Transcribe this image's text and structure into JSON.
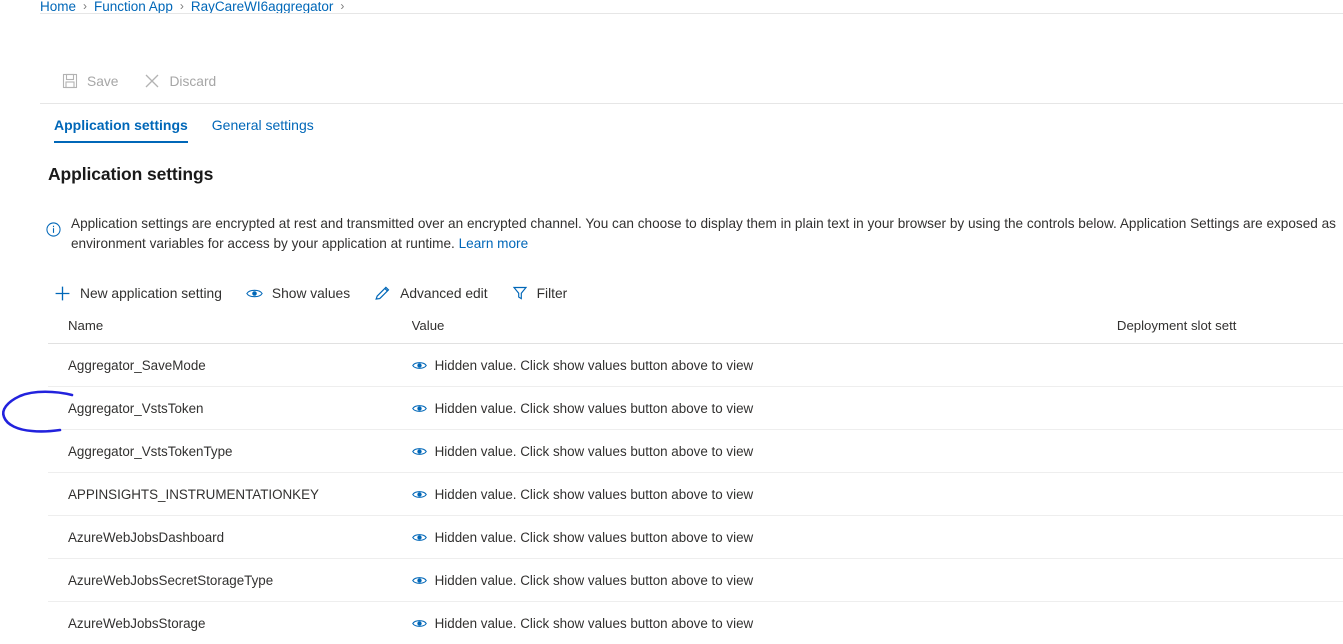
{
  "breadcrumb": {
    "items": [
      "Home",
      "Function App",
      "RayCareWI6aggregator"
    ],
    "separator": "›",
    "trailing_separator": "›"
  },
  "command_bar": {
    "buttons": [
      {
        "label": "Save",
        "icon": "save-icon",
        "disabled": true
      },
      {
        "label": "Discard",
        "icon": "close-x-icon",
        "disabled": true
      }
    ]
  },
  "tabs": [
    {
      "label": "Application settings",
      "active": true
    },
    {
      "label": "General settings",
      "active": false
    }
  ],
  "section": {
    "title": "Application settings"
  },
  "info_banner": {
    "icon": "info-circle-icon",
    "text": "Application settings are encrypted at rest and transmitted over an encrypted channel. You can choose to display them in plain text in your browser by using the controls below. Application Settings are exposed as environment variables for access by your application at runtime. ",
    "link_label": "Learn more"
  },
  "action_bar": {
    "actions": [
      {
        "label": "New application setting",
        "icon": "plus-icon"
      },
      {
        "label": "Show values",
        "icon": "eye-icon"
      },
      {
        "label": "Advanced edit",
        "icon": "pencil-icon"
      },
      {
        "label": "Filter",
        "icon": "funnel-icon"
      }
    ]
  },
  "table": {
    "columns": [
      "Name",
      "Value",
      "Deployment slot sett"
    ],
    "hidden_value_text": "Hidden value. Click show values button above to view",
    "rows": [
      {
        "name": "Aggregator_SaveMode",
        "value": "Hidden value. Click show values button above to view",
        "slot": ""
      },
      {
        "name": "Aggregator_VstsToken",
        "value": "Hidden value. Click show values button above to view",
        "slot": ""
      },
      {
        "name": "Aggregator_VstsTokenType",
        "value": "Hidden value. Click show values button above to view",
        "slot": ""
      },
      {
        "name": "APPINSIGHTS_INSTRUMENTATIONKEY",
        "value": "Hidden value. Click show values button above to view",
        "slot": ""
      },
      {
        "name": "AzureWebJobsDashboard",
        "value": "Hidden value. Click show values button above to view",
        "slot": ""
      },
      {
        "name": "AzureWebJobsSecretStorageType",
        "value": "Hidden value. Click show values button above to view",
        "slot": ""
      },
      {
        "name": "AzureWebJobsStorage",
        "value": "Hidden value. Click show values button above to view",
        "slot": ""
      }
    ]
  },
  "annotation": {
    "shape": "hand-drawn-ellipse",
    "color": "#2222dd",
    "target_row": "Aggregator_VstsToken"
  },
  "colors": {
    "accent": "#0067b8",
    "text": "#323130",
    "disabled": "#a6a6a6",
    "divider": "#e6e6e6",
    "annotation": "#2222dd"
  }
}
